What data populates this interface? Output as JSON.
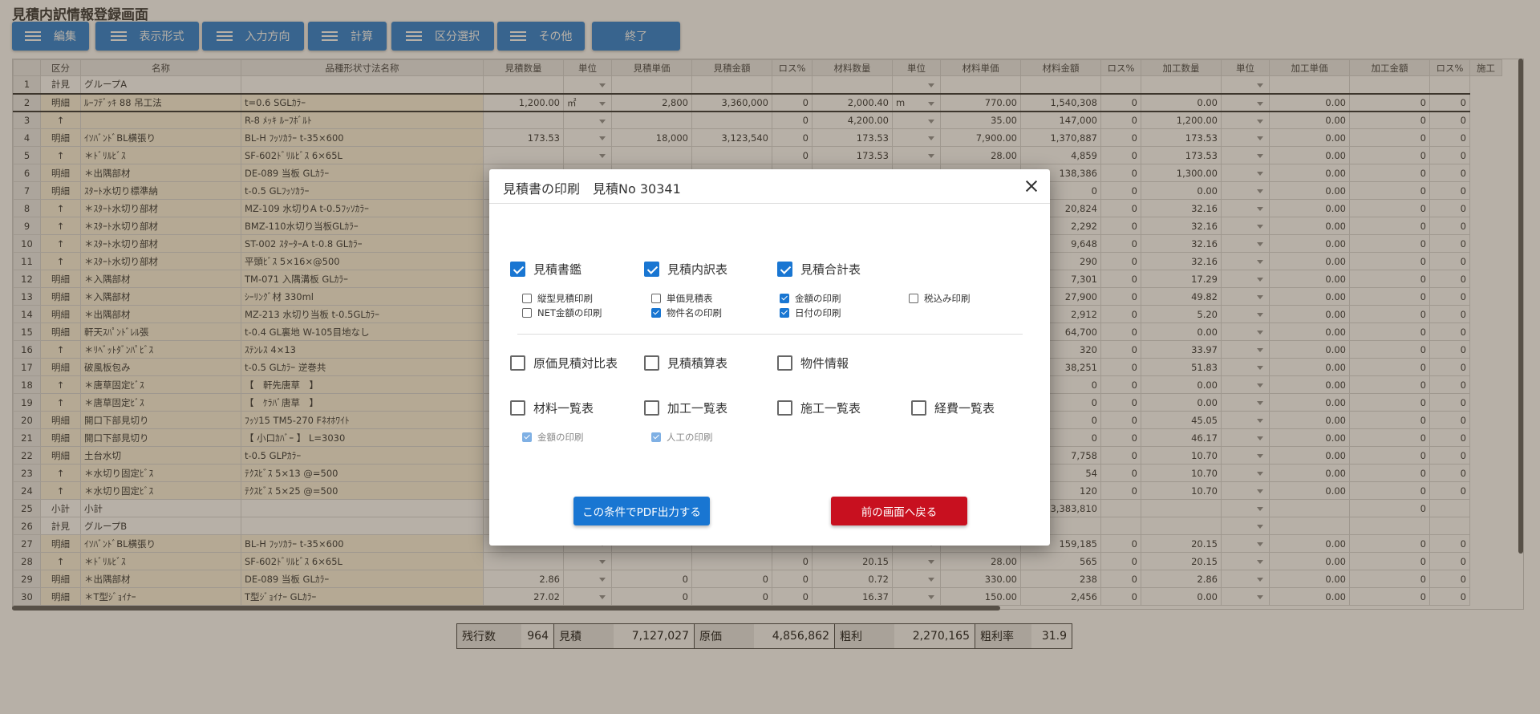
{
  "page": {
    "title": "見積内訳情報登録画面"
  },
  "toolbar": [
    {
      "label": "編集",
      "menu": true
    },
    {
      "label": "表示形式",
      "menu": true
    },
    {
      "label": "入力方向",
      "menu": true
    },
    {
      "label": "計算",
      "menu": true
    },
    {
      "label": "区分選択",
      "menu": true
    },
    {
      "label": "その他",
      "menu": true
    },
    {
      "label": "終了",
      "menu": false
    }
  ],
  "grid": {
    "columns": [
      "",
      "区分",
      "名称",
      "品種形状寸法名称",
      "見積数量",
      "単位",
      "見積単価",
      "見積金額",
      "ロス%",
      "材料数量",
      "単位",
      "材料単価",
      "材料金額",
      "ロス%",
      "加工数量",
      "単位",
      "加工単価",
      "加工金額",
      "ロス%",
      "施工"
    ],
    "rows": [
      [
        "1",
        "計見",
        "グループA",
        "",
        "",
        "",
        "",
        "",
        "",
        "",
        "",
        "",
        "",
        "",
        "",
        "",
        "",
        "",
        ""
      ],
      [
        "2",
        "明細",
        "ﾙｰﾌﾃﾞｯｷ 88 吊工法",
        "t=0.6 SGLｶﾗｰ",
        "1,200.00",
        "㎡",
        "2,800",
        "3,360,000",
        "0",
        "2,000.40",
        "m",
        "770.00",
        "1,540,308",
        "0",
        "0.00",
        "",
        "0.00",
        "0",
        "0"
      ],
      [
        "3",
        "↑",
        "",
        "R-8 ﾒｯｷ ﾙｰﾌﾎﾞﾙﾄ",
        "",
        "",
        "",
        "",
        "0",
        "4,200.00",
        "",
        "35.00",
        "147,000",
        "0",
        "1,200.00",
        "",
        "0.00",
        "0",
        "0"
      ],
      [
        "4",
        "明細",
        "ｲｿﾊﾞﾝﾄﾞBL横張り",
        "BL-H ﾌｯｿｶﾗｰ t-35×600",
        "173.53",
        "",
        "18,000",
        "3,123,540",
        "0",
        "173.53",
        "",
        "7,900.00",
        "1,370,887",
        "0",
        "173.53",
        "",
        "0.00",
        "0",
        "0"
      ],
      [
        "5",
        "↑",
        "＊ﾄﾞﾘﾙﾋﾞｽ",
        "SF-602ﾄﾞﾘﾙﾋﾞｽ 6×65L",
        "",
        "",
        "",
        "",
        "0",
        "173.53",
        "",
        "28.00",
        "4,859",
        "0",
        "173.53",
        "",
        "0.00",
        "0",
        "0"
      ],
      [
        "6",
        "明細",
        "＊出隅部材",
        "DE-089 当板 GLｶﾗｰ",
        "",
        "",
        "",
        "",
        "",
        "",
        "",
        "",
        "138,386",
        "0",
        "1,300.00",
        "",
        "0.00",
        "0",
        "0"
      ],
      [
        "7",
        "明細",
        "ｽﾀｰﾄ水切り標準納",
        "t-0.5 GLﾌｯｿｶﾗｰ",
        "",
        "",
        "",
        "",
        "",
        "",
        "",
        "",
        "0",
        "0",
        "0.00",
        "",
        "0.00",
        "0",
        "0"
      ],
      [
        "8",
        "↑",
        "＊ｽﾀｰﾄ水切り部材",
        "MZ-109 水切りA t-0.5ﾌｯｿｶﾗｰ",
        "",
        "",
        "",
        "",
        "",
        "",
        "",
        "",
        "20,824",
        "0",
        "32.16",
        "",
        "0.00",
        "0",
        "0"
      ],
      [
        "9",
        "↑",
        "＊ｽﾀｰﾄ水切り部材",
        "BMZ-110水切り当板GLｶﾗｰ",
        "",
        "",
        "",
        "",
        "",
        "",
        "",
        "",
        "2,292",
        "0",
        "32.16",
        "",
        "0.00",
        "0",
        "0"
      ],
      [
        "10",
        "↑",
        "＊ｽﾀｰﾄ水切り部材",
        "ST-002 ｽﾀｰﾀｰA t-0.8 GLｶﾗｰ",
        "",
        "",
        "",
        "",
        "",
        "",
        "",
        "",
        "9,648",
        "0",
        "32.16",
        "",
        "0.00",
        "0",
        "0"
      ],
      [
        "11",
        "↑",
        "＊ｽﾀｰﾄ水切り部材",
        "平頭ﾋﾞｽ 5×16×@500",
        "",
        "",
        "",
        "",
        "",
        "",
        "",
        "",
        "290",
        "0",
        "32.16",
        "",
        "0.00",
        "0",
        "0"
      ],
      [
        "12",
        "明細",
        "＊入隅部材",
        "TM-071 入隅溝板 GLｶﾗｰ",
        "",
        "",
        "",
        "",
        "",
        "",
        "",
        "",
        "7,301",
        "0",
        "17.29",
        "",
        "0.00",
        "0",
        "0"
      ],
      [
        "13",
        "明細",
        "＊入隅部材",
        "ｼｰﾘﾝｸﾞ材 330ml",
        "",
        "",
        "",
        "",
        "",
        "",
        "",
        "",
        "27,900",
        "0",
        "49.82",
        "",
        "0.00",
        "0",
        "0"
      ],
      [
        "14",
        "明細",
        "＊出隅部材",
        "MZ-213 水切り当板 t-0.5GLｶﾗｰ",
        "",
        "",
        "",
        "",
        "",
        "",
        "",
        "",
        "2,912",
        "0",
        "5.20",
        "",
        "0.00",
        "0",
        "0"
      ],
      [
        "15",
        "明細",
        "軒天ｽﾊﾟﾝﾄﾞﾚﾙ張",
        "t-0.4 GL裏地 W-105目地なし",
        "",
        "",
        "",
        "",
        "",
        "",
        "",
        "",
        "64,700",
        "0",
        "0.00",
        "",
        "0.00",
        "0",
        "0"
      ],
      [
        "16",
        "↑",
        "＊ﾘﾍﾞｯﾄﾀﾞﾝﾊﾟﾋﾞｽ",
        "ｽﾃﾝﾚｽ 4×13",
        "",
        "",
        "",
        "",
        "",
        "",
        "",
        "",
        "320",
        "0",
        "33.97",
        "",
        "0.00",
        "0",
        "0"
      ],
      [
        "17",
        "明細",
        "破風板包み",
        "t-0.5 GLｶﾗｰ 逆巻共",
        "",
        "",
        "",
        "",
        "",
        "",
        "",
        "",
        "38,251",
        "0",
        "51.83",
        "",
        "0.00",
        "0",
        "0"
      ],
      [
        "18",
        "↑",
        "＊唐草固定ﾋﾞｽ",
        "【　軒先唐草　】",
        "",
        "",
        "",
        "",
        "",
        "",
        "",
        "",
        "0",
        "0",
        "0.00",
        "",
        "0.00",
        "0",
        "0"
      ],
      [
        "19",
        "↑",
        "＊唐草固定ﾋﾞｽ",
        "【　ｹﾗﾊﾞ唐草　】",
        "",
        "",
        "",
        "",
        "",
        "",
        "",
        "",
        "0",
        "0",
        "0.00",
        "",
        "0.00",
        "0",
        "0"
      ],
      [
        "20",
        "明細",
        "開口下部見切り",
        "ﾌｯｿ15 TM5-270 Fﾈｵﾎﾜｲﾄ",
        "",
        "",
        "",
        "",
        "",
        "",
        "",
        "",
        "0",
        "0",
        "45.05",
        "",
        "0.00",
        "0",
        "0"
      ],
      [
        "21",
        "明細",
        "開口下部見切り",
        "【 小口ｶﾊﾞｰ 】 L=3030",
        "",
        "",
        "",
        "",
        "",
        "",
        "",
        "",
        "0",
        "0",
        "46.17",
        "",
        "0.00",
        "0",
        "0"
      ],
      [
        "22",
        "明細",
        "土台水切",
        "t-0.5 GLPｶﾗｰ",
        "",
        "",
        "",
        "",
        "",
        "",
        "",
        "",
        "7,758",
        "0",
        "10.70",
        "",
        "0.00",
        "0",
        "0"
      ],
      [
        "23",
        "↑",
        "＊水切り固定ﾋﾞｽ",
        "ﾃｸｽﾋﾞｽ 5×13 @=500",
        "",
        "",
        "",
        "",
        "",
        "",
        "",
        "",
        "54",
        "0",
        "10.70",
        "",
        "0.00",
        "0",
        "0"
      ],
      [
        "24",
        "↑",
        "＊水切り固定ﾋﾞｽ",
        "ﾃｸｽﾋﾞｽ 5×25 @=500",
        "",
        "",
        "",
        "",
        "",
        "",
        "",
        "",
        "120",
        "0",
        "10.70",
        "",
        "0.00",
        "0",
        "0"
      ],
      [
        "25",
        "小計",
        "小計",
        "",
        "",
        "",
        "",
        "",
        "",
        "",
        "",
        "",
        "3,383,810",
        "",
        "",
        "",
        "",
        "0",
        ""
      ],
      [
        "26",
        "計見",
        "グループB",
        "",
        "",
        "",
        "",
        "",
        "",
        "",
        "",
        "",
        "",
        "",
        "",
        "",
        "",
        "",
        ""
      ],
      [
        "27",
        "明細",
        "ｲｿﾊﾞﾝﾄﾞBL横張り",
        "BL-H ﾌｯｿｶﾗｰ t-35×600",
        "",
        "",
        "",
        "",
        "",
        "",
        "",
        "",
        "159,185",
        "0",
        "20.15",
        "",
        "0.00",
        "0",
        "0"
      ],
      [
        "28",
        "↑",
        "＊ﾄﾞﾘﾙﾋﾞｽ",
        "SF-602ﾄﾞﾘﾙﾋﾞｽ 6×65L",
        "",
        "",
        "",
        "",
        "0",
        "20.15",
        "",
        "28.00",
        "565",
        "0",
        "20.15",
        "",
        "0.00",
        "0",
        "0"
      ],
      [
        "29",
        "明細",
        "＊出隅部材",
        "DE-089 当板 GLｶﾗｰ",
        "2.86",
        "",
        "0",
        "0",
        "0",
        "0.72",
        "",
        "330.00",
        "238",
        "0",
        "2.86",
        "",
        "0.00",
        "0",
        "0"
      ],
      [
        "30",
        "明細",
        "＊T型ｼﾞｮｲﾅｰ",
        "T型ｼﾞｮｲﾅｰ GLｶﾗｰ",
        "27.02",
        "",
        "0",
        "0",
        "0",
        "16.37",
        "",
        "150.00",
        "2,456",
        "0",
        "0.00",
        "",
        "0.00",
        "0",
        "0"
      ]
    ]
  },
  "summary": [
    {
      "label": "残行数",
      "value": "964"
    },
    {
      "label": "見積",
      "value": "7,127,027"
    },
    {
      "label": "原価",
      "value": "4,856,862"
    },
    {
      "label": "粗利",
      "value": "2,270,165"
    },
    {
      "label": "粗利率",
      "value": "31.9"
    }
  ],
  "modal": {
    "title": "見積書の印刷　見積No 30341",
    "options": {
      "mitsumori_kagami": {
        "label": "見積書鑑",
        "checked": true
      },
      "uchiwake": {
        "label": "見積内訳表",
        "checked": true
      },
      "goukei": {
        "label": "見積合計表",
        "checked": true
      },
      "tategata": {
        "label": "縦型見積印刷",
        "checked": false
      },
      "net_kingaku": {
        "label": "NET金額の印刷",
        "checked": false
      },
      "tanka": {
        "label": "単価見積表",
        "checked": false
      },
      "bukken_mei": {
        "label": "物件名の印刷",
        "checked": true
      },
      "kingaku": {
        "label": "金額の印刷",
        "checked": true
      },
      "hizuke": {
        "label": "日付の印刷",
        "checked": true
      },
      "zeikomi": {
        "label": "税込み印刷",
        "checked": false
      },
      "genka_taihi": {
        "label": "原価見積対比表",
        "checked": false
      },
      "sekisan": {
        "label": "見積積算表",
        "checked": false
      },
      "bukken_jouhou": {
        "label": "物件情報",
        "checked": false
      },
      "zairyou": {
        "label": "材料一覧表",
        "checked": false
      },
      "kakou": {
        "label": "加工一覧表",
        "checked": false
      },
      "sekou": {
        "label": "施工一覧表",
        "checked": false
      },
      "keihi": {
        "label": "経費一覧表",
        "checked": false
      },
      "zairyou_kingaku": {
        "label": "金額の印刷",
        "checked": true
      },
      "jinkou": {
        "label": "人工の印刷",
        "checked": true
      }
    },
    "pdf_button": "この条件でPDF出力する",
    "back_button": "前の画面へ戻る"
  },
  "colors": {
    "primary": "#1976d2",
    "danger": "#c8101f",
    "row_tan": "#fbf3dd"
  }
}
